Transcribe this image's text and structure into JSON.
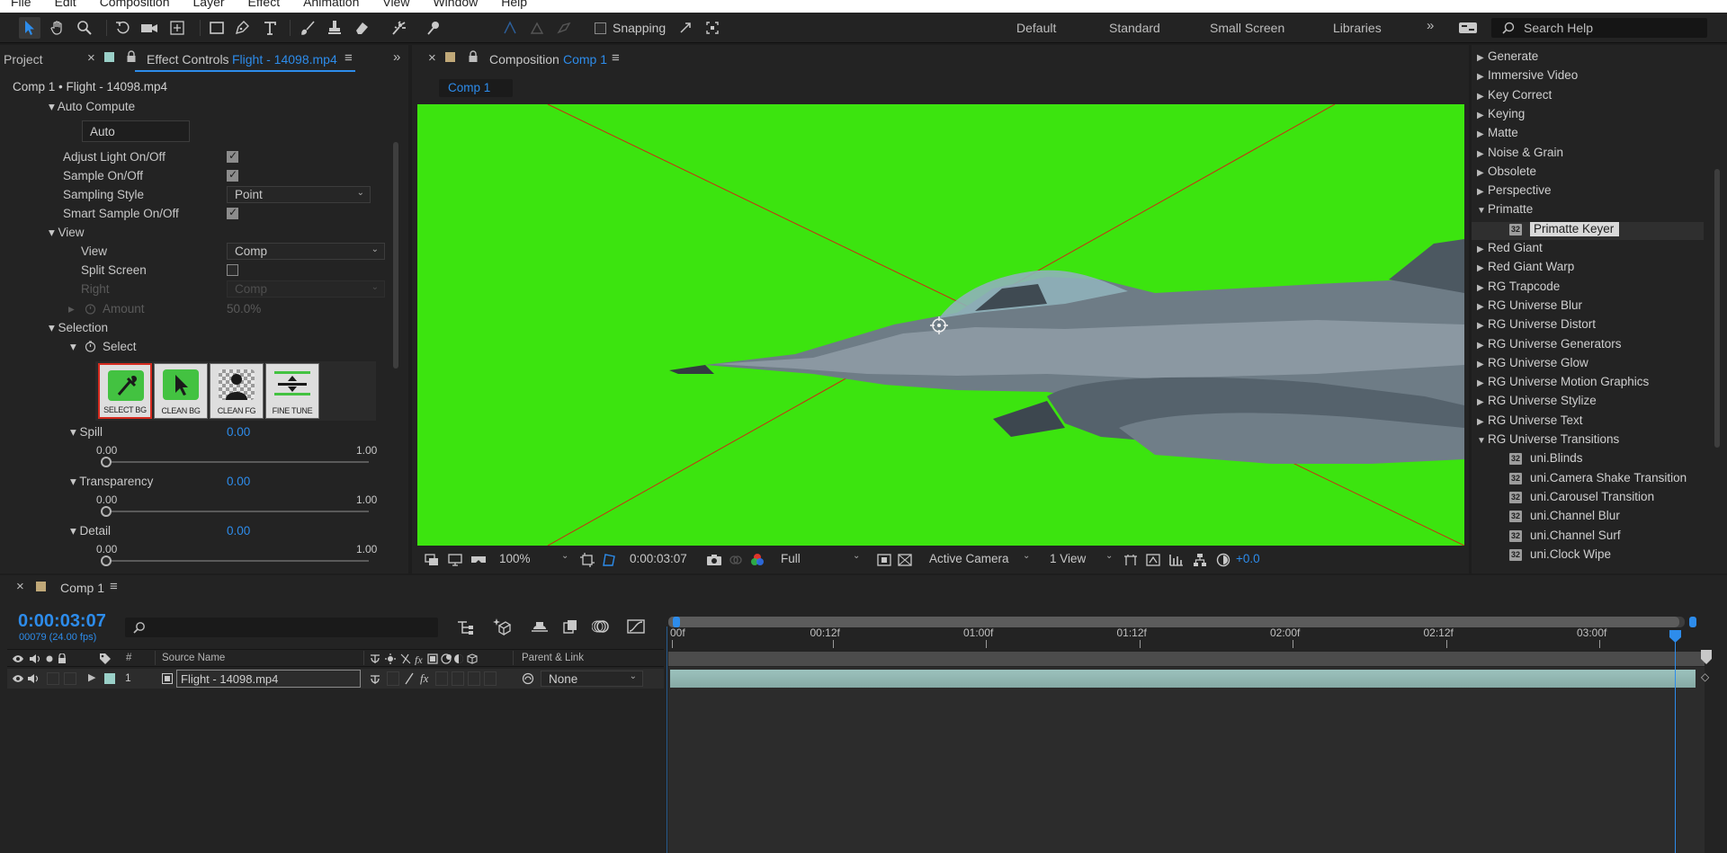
{
  "menu": [
    "File",
    "Edit",
    "Composition",
    "Layer",
    "Effect",
    "Animation",
    "View",
    "Window",
    "Help"
  ],
  "toolbar": {
    "snapping_label": "Snapping",
    "workspaces": [
      "Default",
      "Standard",
      "Small Screen",
      "Libraries"
    ],
    "search_placeholder": "Search Help"
  },
  "left_panel": {
    "project_tab": "Project",
    "effect_controls_tab_prefix": "Effect Controls",
    "effect_controls_tab_file": "Flight - 14098.mp4",
    "breadcrumb": "Comp 1 • Flight - 14098.mp4",
    "auto_compute": {
      "label": "Auto Compute",
      "button": "Auto"
    },
    "adjust_light": {
      "label": "Adjust Light On/Off",
      "checked": true
    },
    "sample_on": {
      "label": "Sample On/Off",
      "checked": true
    },
    "sampling_style": {
      "label": "Sampling Style",
      "value": "Point"
    },
    "smart_sample": {
      "label": "Smart Sample On/Off",
      "checked": true
    },
    "view_group": "View",
    "view": {
      "label": "View",
      "value": "Comp"
    },
    "split_screen": {
      "label": "Split Screen",
      "checked": false
    },
    "right": {
      "label": "Right",
      "value": "Comp"
    },
    "amount": {
      "label": "Amount",
      "value": "50.0%"
    },
    "selection_group": "Selection",
    "select_label": "Select",
    "select_buttons": [
      "SELECT BG",
      "CLEAN BG",
      "CLEAN FG",
      "FINE TUNE"
    ],
    "spill": {
      "label": "Spill",
      "value": "0.00",
      "min": "0.00",
      "max": "1.00",
      "level": 0
    },
    "transparency": {
      "label": "Transparency",
      "value": "0.00",
      "min": "0.00",
      "max": "1.00",
      "level": 0
    },
    "detail": {
      "label": "Detail",
      "value": "0.00",
      "min": "0.00",
      "max": "1.00",
      "level": 0
    }
  },
  "composition": {
    "tab_prefix": "Composition",
    "tab_name": "Comp 1",
    "sub_tab": "Comp 1",
    "bg_color": "#3ce40f",
    "zoom": "100%",
    "timecode": "0:00:03:07",
    "resolution": "Full",
    "camera": "Active Camera",
    "views": "1 View",
    "exposure": "+0.0"
  },
  "effects_list": {
    "categories": [
      {
        "label": "Generate",
        "expanded": false
      },
      {
        "label": "Immersive Video",
        "expanded": false
      },
      {
        "label": "Key Correct",
        "expanded": false
      },
      {
        "label": "Keying",
        "expanded": false
      },
      {
        "label": "Matte",
        "expanded": false
      },
      {
        "label": "Noise & Grain",
        "expanded": false
      },
      {
        "label": "Obsolete",
        "expanded": false
      },
      {
        "label": "Perspective",
        "expanded": false
      },
      {
        "label": "Primatte",
        "expanded": true
      }
    ],
    "primatte_child": "Primatte Keyer",
    "categories2": [
      {
        "label": "Red Giant",
        "expanded": false
      },
      {
        "label": "Red Giant Warp",
        "expanded": false
      },
      {
        "label": "RG Trapcode",
        "expanded": false
      },
      {
        "label": "RG Universe Blur",
        "expanded": false
      },
      {
        "label": "RG Universe Distort",
        "expanded": false
      },
      {
        "label": "RG Universe Generators",
        "expanded": false
      },
      {
        "label": "RG Universe Glow",
        "expanded": false
      },
      {
        "label": "RG Universe Motion Graphics",
        "expanded": false
      },
      {
        "label": "RG Universe Stylize",
        "expanded": false
      },
      {
        "label": "RG Universe Text",
        "expanded": false
      },
      {
        "label": "RG Universe Transitions",
        "expanded": true
      }
    ],
    "transitions": [
      "uni.Blinds",
      "uni.Camera Shake Transition",
      "uni.Carousel Transition",
      "uni.Channel Blur",
      "uni.Channel Surf",
      "uni.Clock Wipe"
    ],
    "badge": "32"
  },
  "timeline": {
    "tab": "Comp 1",
    "timecode": "0:00:03:07",
    "frame_info": "00079 (24.00 fps)",
    "headers": {
      "number": "#",
      "source_name": "Source Name",
      "parent_link": "Parent & Link"
    },
    "layer": {
      "index": "1",
      "name": "Flight - 14098.mp4",
      "parent": "None"
    },
    "ruler": [
      "00f",
      "00:12f",
      "01:00f",
      "01:12f",
      "02:00f",
      "02:12f",
      "03:00f"
    ],
    "colors": {
      "accent": "#2d8ceb",
      "layer_bar": "#8fb5b0",
      "label": "#9ad0c8"
    }
  }
}
